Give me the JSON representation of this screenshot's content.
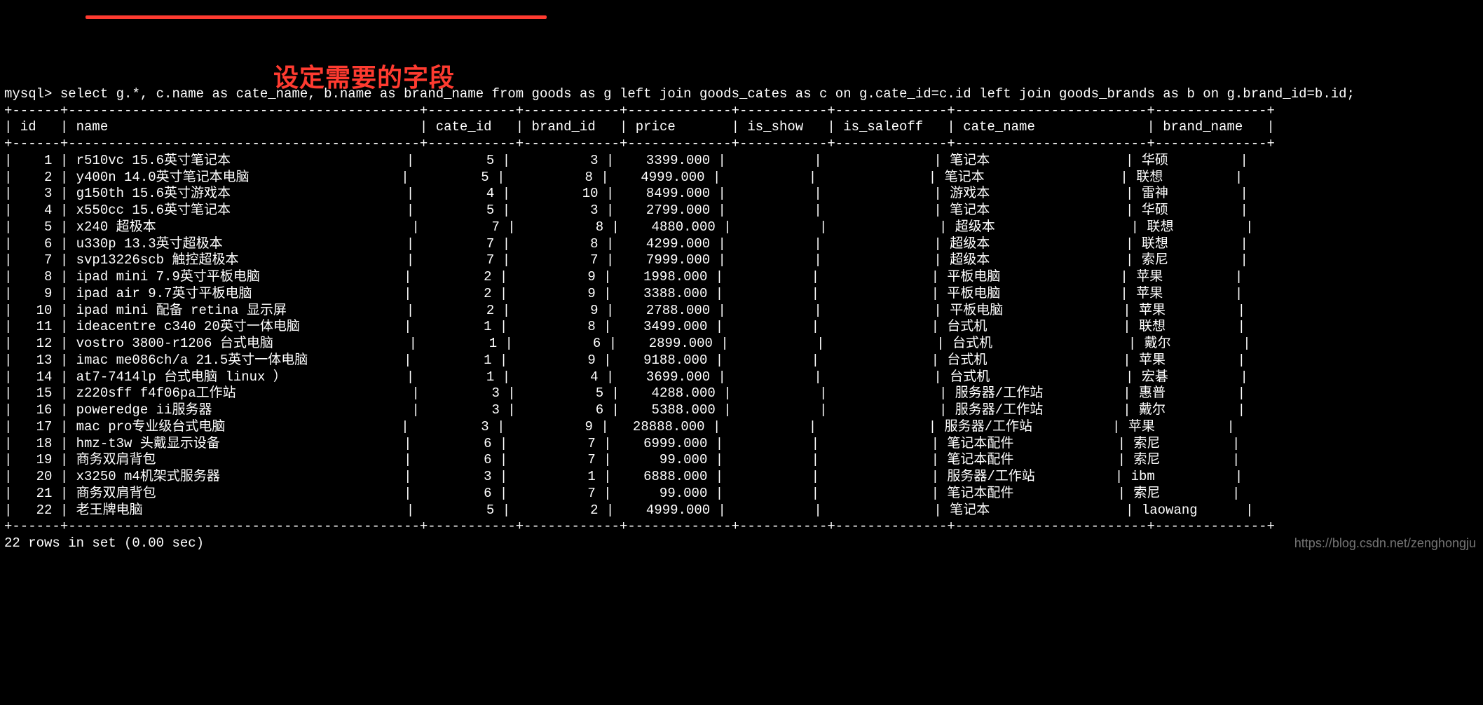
{
  "prompt_prefix": "mysql> ",
  "sql": "select g.*, c.name as cate_name, b.name as brand_name from goods as g left join goods_cates as c on g.cate_id=c.id left join goods_brands as b on g.brand_id=b.id;",
  "annotation_text": "设定需要的字段",
  "watermark": "https://blog.csdn.net/zenghongju",
  "footer": "22 rows in set (0.00 sec)",
  "columns": [
    {
      "key": "id",
      "label": "id",
      "width": 4,
      "align": "right"
    },
    {
      "key": "name",
      "label": "name",
      "width": 42,
      "align": "left"
    },
    {
      "key": "cate_id",
      "label": "cate_id",
      "width": 9,
      "align": "right"
    },
    {
      "key": "brand_id",
      "label": "brand_id",
      "width": 10,
      "align": "right"
    },
    {
      "key": "price",
      "label": "price",
      "width": 11,
      "align": "right"
    },
    {
      "key": "is_show",
      "label": "is_show",
      "width": 9,
      "align": "left"
    },
    {
      "key": "is_saleoff",
      "label": "is_saleoff",
      "width": 12,
      "align": "left"
    },
    {
      "key": "cate_name",
      "label": "cate_name",
      "width": 22,
      "align": "left"
    },
    {
      "key": "brand_name",
      "label": "brand_name",
      "width": 12,
      "align": "left"
    }
  ],
  "rows": [
    {
      "id": "1",
      "name": "r510vc 15.6英寸笔记本",
      "cate_id": "5",
      "brand_id": "3",
      "price": "3399.000",
      "is_show": "",
      "is_saleoff": "",
      "cate_name": "笔记本",
      "brand_name": "华硕"
    },
    {
      "id": "2",
      "name": "y400n 14.0英寸笔记本电脑",
      "cate_id": "5",
      "brand_id": "8",
      "price": "4999.000",
      "is_show": "",
      "is_saleoff": "",
      "cate_name": "笔记本",
      "brand_name": "联想"
    },
    {
      "id": "3",
      "name": "g150th 15.6英寸游戏本",
      "cate_id": "4",
      "brand_id": "10",
      "price": "8499.000",
      "is_show": "",
      "is_saleoff": "",
      "cate_name": "游戏本",
      "brand_name": "雷神"
    },
    {
      "id": "4",
      "name": "x550cc 15.6英寸笔记本",
      "cate_id": "5",
      "brand_id": "3",
      "price": "2799.000",
      "is_show": "",
      "is_saleoff": "",
      "cate_name": "笔记本",
      "brand_name": "华硕"
    },
    {
      "id": "5",
      "name": "x240 超极本",
      "cate_id": "7",
      "brand_id": "8",
      "price": "4880.000",
      "is_show": "",
      "is_saleoff": "",
      "cate_name": "超级本",
      "brand_name": "联想"
    },
    {
      "id": "6",
      "name": "u330p 13.3英寸超极本",
      "cate_id": "7",
      "brand_id": "8",
      "price": "4299.000",
      "is_show": "",
      "is_saleoff": "",
      "cate_name": "超级本",
      "brand_name": "联想"
    },
    {
      "id": "7",
      "name": "svp13226scb 触控超极本",
      "cate_id": "7",
      "brand_id": "7",
      "price": "7999.000",
      "is_show": "",
      "is_saleoff": "",
      "cate_name": "超级本",
      "brand_name": "索尼"
    },
    {
      "id": "8",
      "name": "ipad mini 7.9英寸平板电脑",
      "cate_id": "2",
      "brand_id": "9",
      "price": "1998.000",
      "is_show": "",
      "is_saleoff": "",
      "cate_name": "平板电脑",
      "brand_name": "苹果"
    },
    {
      "id": "9",
      "name": "ipad air 9.7英寸平板电脑",
      "cate_id": "2",
      "brand_id": "9",
      "price": "3388.000",
      "is_show": "",
      "is_saleoff": "",
      "cate_name": "平板电脑",
      "brand_name": "苹果"
    },
    {
      "id": "10",
      "name": "ipad mini 配备 retina 显示屏",
      "cate_id": "2",
      "brand_id": "9",
      "price": "2788.000",
      "is_show": "",
      "is_saleoff": "",
      "cate_name": "平板电脑",
      "brand_name": "苹果"
    },
    {
      "id": "11",
      "name": "ideacentre c340 20英寸一体电脑",
      "cate_id": "1",
      "brand_id": "8",
      "price": "3499.000",
      "is_show": "",
      "is_saleoff": "",
      "cate_name": "台式机",
      "brand_name": "联想"
    },
    {
      "id": "12",
      "name": "vostro 3800-r1206 台式电脑",
      "cate_id": "1",
      "brand_id": "6",
      "price": "2899.000",
      "is_show": "",
      "is_saleoff": "",
      "cate_name": "台式机",
      "brand_name": "戴尔"
    },
    {
      "id": "13",
      "name": "imac me086ch/a 21.5英寸一体电脑",
      "cate_id": "1",
      "brand_id": "9",
      "price": "9188.000",
      "is_show": "",
      "is_saleoff": "",
      "cate_name": "台式机",
      "brand_name": "苹果"
    },
    {
      "id": "14",
      "name": "at7-7414lp 台式电脑 linux ）",
      "cate_id": "1",
      "brand_id": "4",
      "price": "3699.000",
      "is_show": "",
      "is_saleoff": "",
      "cate_name": "台式机",
      "brand_name": "宏碁"
    },
    {
      "id": "15",
      "name": "z220sff f4f06pa工作站",
      "cate_id": "3",
      "brand_id": "5",
      "price": "4288.000",
      "is_show": "",
      "is_saleoff": "",
      "cate_name": "服务器/工作站",
      "brand_name": "惠普"
    },
    {
      "id": "16",
      "name": "poweredge ii服务器",
      "cate_id": "3",
      "brand_id": "6",
      "price": "5388.000",
      "is_show": "",
      "is_saleoff": "",
      "cate_name": "服务器/工作站",
      "brand_name": "戴尔"
    },
    {
      "id": "17",
      "name": "mac pro专业级台式电脑",
      "cate_id": "3",
      "brand_id": "9",
      "price": "28888.000",
      "is_show": "",
      "is_saleoff": "",
      "cate_name": "服务器/工作站",
      "brand_name": "苹果"
    },
    {
      "id": "18",
      "name": "hmz-t3w 头戴显示设备",
      "cate_id": "6",
      "brand_id": "7",
      "price": "6999.000",
      "is_show": "",
      "is_saleoff": "",
      "cate_name": "笔记本配件",
      "brand_name": "索尼"
    },
    {
      "id": "19",
      "name": "商务双肩背包",
      "cate_id": "6",
      "brand_id": "7",
      "price": "99.000",
      "is_show": "",
      "is_saleoff": "",
      "cate_name": "笔记本配件",
      "brand_name": "索尼"
    },
    {
      "id": "20",
      "name": "x3250 m4机架式服务器",
      "cate_id": "3",
      "brand_id": "1",
      "price": "6888.000",
      "is_show": "",
      "is_saleoff": "",
      "cate_name": "服务器/工作站",
      "brand_name": "ibm"
    },
    {
      "id": "21",
      "name": "商务双肩背包",
      "cate_id": "6",
      "brand_id": "7",
      "price": "99.000",
      "is_show": "",
      "is_saleoff": "",
      "cate_name": "笔记本配件",
      "brand_name": "索尼"
    },
    {
      "id": "22",
      "name": "老王牌电脑",
      "cate_id": "5",
      "brand_id": "2",
      "price": "4999.000",
      "is_show": "",
      "is_saleoff": "",
      "cate_name": "笔记本",
      "brand_name": "laowang"
    }
  ]
}
